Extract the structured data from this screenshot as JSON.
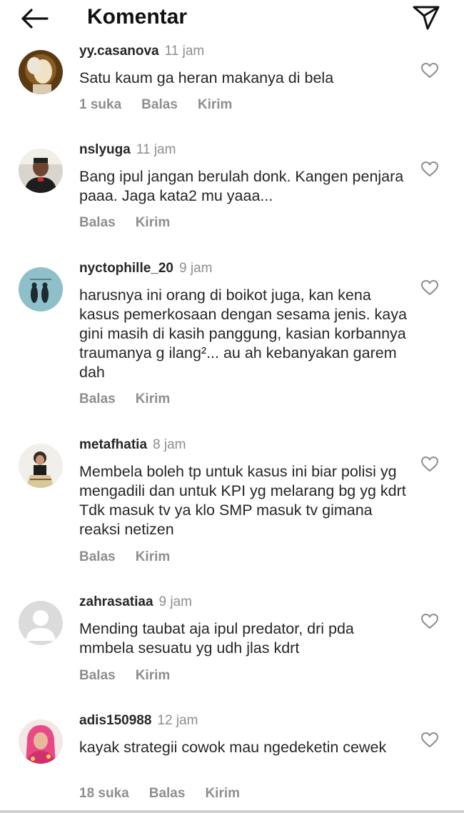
{
  "header": {
    "title": "Komentar",
    "back_icon": "arrow-left-icon",
    "send_icon": "paper-plane-icon"
  },
  "comments": [
    {
      "username": "yy.casanova",
      "time": "11 jam",
      "text": "Satu kaum ga heran makanya di bela",
      "likes": "1 suka",
      "reply": "Balas",
      "send": "Kirim"
    },
    {
      "username": "nslyuga",
      "time": "11 jam",
      "text": "Bang ipul jangan berulah donk. Kangen penjara paaa. Jaga kata2 mu yaaa...",
      "reply": "Balas",
      "send": "Kirim"
    },
    {
      "username": "nyctophille_20",
      "time": "9 jam",
      "text": "harusnya ini orang di boikot juga, kan kena kasus pemerkosaan dengan sesama jenis. kaya gini masih di kasih panggung, kasian korbannya traumanya g ilang²... au ah kebanyakan garem dah",
      "reply": "Balas",
      "send": "Kirim"
    },
    {
      "username": "metafhatia",
      "time": "8 jam",
      "text": "Membela boleh tp untuk kasus ini biar polisi yg mengadili dan untuk KPI yg melarang bg yg kdrt Tdk masuk tv ya klo SMP masuk tv gimana reaksi netizen",
      "reply": "Balas",
      "send": "Kirim"
    },
    {
      "username": "zahrasatiaa",
      "time": "9 jam",
      "text": "Mending taubat aja ipul predator, dri pda mmbela sesuatu yg udh jlas kdrt",
      "reply": "Balas",
      "send": "Kirim"
    },
    {
      "username": "adis150988",
      "time": "12 jam",
      "text": "kayak strategii cowok mau ngedeketin cewek",
      "likes": "18 suka",
      "reply": "Balas",
      "send": "Kirim"
    }
  ]
}
